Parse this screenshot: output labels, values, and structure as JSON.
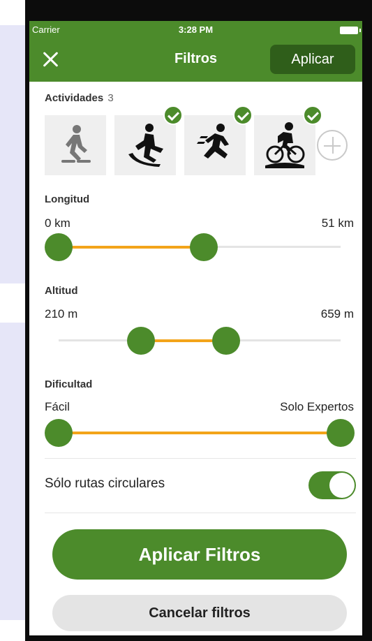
{
  "status": {
    "carrier": "Carrier",
    "time": "3:28 PM"
  },
  "nav": {
    "title": "Filtros",
    "apply": "Aplicar"
  },
  "activities": {
    "label": "Actividades",
    "count": "3",
    "items": [
      {
        "name": "snowshoeing",
        "selected": false
      },
      {
        "name": "sledding",
        "selected": true
      },
      {
        "name": "running",
        "selected": true
      },
      {
        "name": "mountain-biking",
        "selected": true
      }
    ]
  },
  "length": {
    "label": "Longitud",
    "min": "0 km",
    "max": "51 km"
  },
  "altitude": {
    "label": "Altitud",
    "min": "210 m",
    "max": "659 m"
  },
  "difficulty": {
    "label": "Dificultad",
    "min": "Fácil",
    "max": "Solo Expertos"
  },
  "circular": {
    "label": "Sólo rutas circulares",
    "enabled": true
  },
  "buttons": {
    "apply": "Aplicar Filtros",
    "cancel": "Cancelar filtros"
  },
  "colors": {
    "primary": "#4c8b2b",
    "accent": "#f3a41a",
    "dark_button": "#2f5e1a"
  }
}
